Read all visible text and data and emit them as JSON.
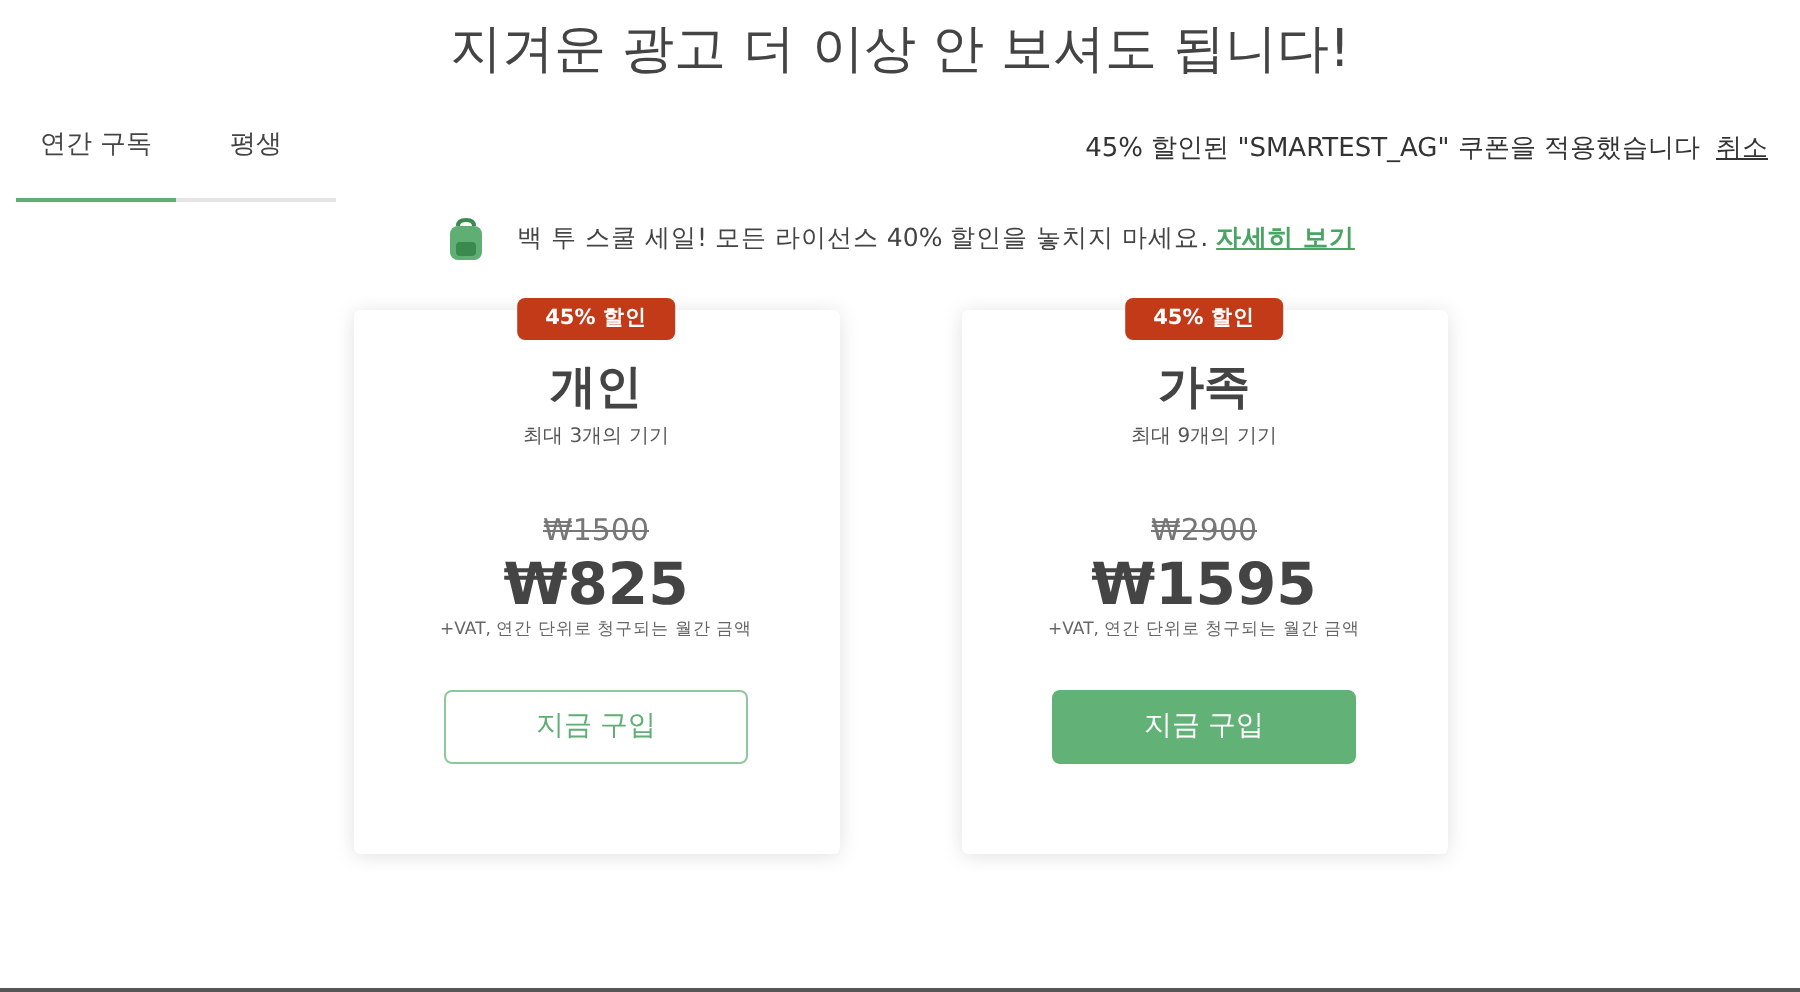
{
  "heading": "지겨운 광고 더 이상 안 보셔도 됩니다!",
  "tabs": [
    {
      "label": "연간 구독",
      "selected": true
    },
    {
      "label": "평생",
      "selected": false
    }
  ],
  "coupon": {
    "text": "45% 할인된 \"SMARTEST_AG\" 쿠폰을 적용했습니다",
    "cancel": "취소"
  },
  "promo": {
    "text": "백 투 스쿨 세일! 모든 라이선스 40% 할인을 놓치지 마세요.",
    "link": "자세히 보기"
  },
  "plans": [
    {
      "badge": "45% 할인",
      "name": "개인",
      "devices": "최대 3개의 기기",
      "old_price": "₩1500",
      "price": "₩825",
      "note": "+VAT, 연간 단위로 청구되는 월간 금액",
      "button": {
        "label": "지금 구입",
        "kind": "outline"
      }
    },
    {
      "badge": "45% 할인",
      "name": "가족",
      "devices": "최대 9개의 기기",
      "old_price": "₩2900",
      "price": "₩1595",
      "note": "+VAT, 연간 단위로 청구되는 월간 금액",
      "button": {
        "label": "지금 구입",
        "kind": "filled"
      }
    }
  ]
}
